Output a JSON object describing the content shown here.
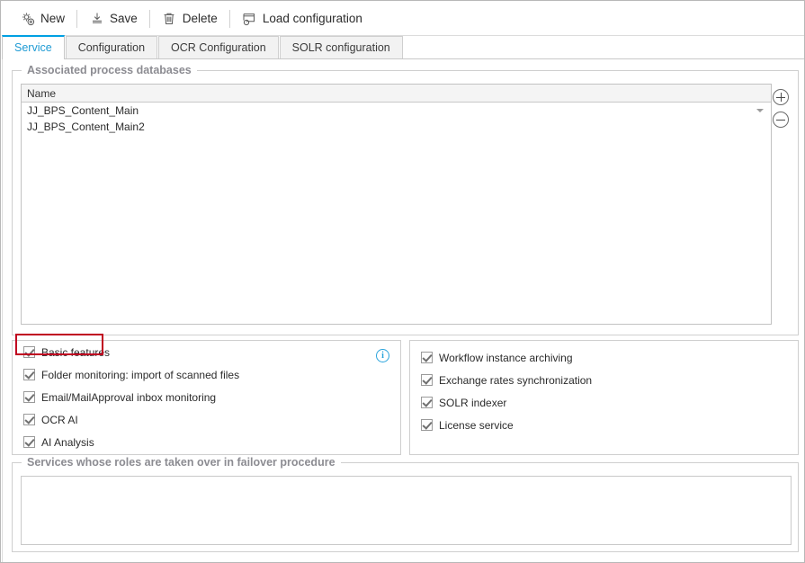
{
  "toolbar": {
    "items": [
      {
        "label": "New",
        "icon": "gear-plus-icon"
      },
      {
        "label": "Save",
        "icon": "save-icon"
      },
      {
        "label": "Delete",
        "icon": "trash-icon"
      },
      {
        "label": "Load configuration",
        "icon": "load-configuration-icon"
      }
    ]
  },
  "tabs": [
    {
      "label": "Service",
      "active": true
    },
    {
      "label": "Configuration",
      "active": false
    },
    {
      "label": "OCR Configuration",
      "active": false
    },
    {
      "label": "SOLR configuration",
      "active": false
    }
  ],
  "databases_group": {
    "legend": "Associated process databases",
    "column_header": "Name",
    "rows": [
      {
        "name": "JJ_BPS_Content_Main",
        "has_caret": true
      },
      {
        "name": "JJ_BPS_Content_Main2",
        "has_caret": false
      }
    ],
    "add_button": "+",
    "remove_button": "−"
  },
  "features": {
    "info_icon_label": "i",
    "left": [
      {
        "label": "Basic features",
        "checked": true,
        "highlighted": true
      },
      {
        "label": "Folder monitoring: import of scanned files",
        "checked": true
      },
      {
        "label": "Email/MailApproval inbox monitoring",
        "checked": true
      },
      {
        "label": "OCR AI",
        "checked": true
      },
      {
        "label": "AI Analysis",
        "checked": true
      }
    ],
    "right": [
      {
        "label": "Workflow instance archiving",
        "checked": true
      },
      {
        "label": "Exchange rates synchronization",
        "checked": true
      },
      {
        "label": "SOLR indexer",
        "checked": true
      },
      {
        "label": "License service",
        "checked": true
      }
    ]
  },
  "failover_group": {
    "legend": "Services whose roles are taken over in failover procedure",
    "items": []
  },
  "colors": {
    "accent": "#00a0e3",
    "active_tab_text": "#1f9bd4",
    "highlight_border": "#c00020",
    "legend_text": "#8c8c92",
    "info_icon": "#29a3dc"
  }
}
